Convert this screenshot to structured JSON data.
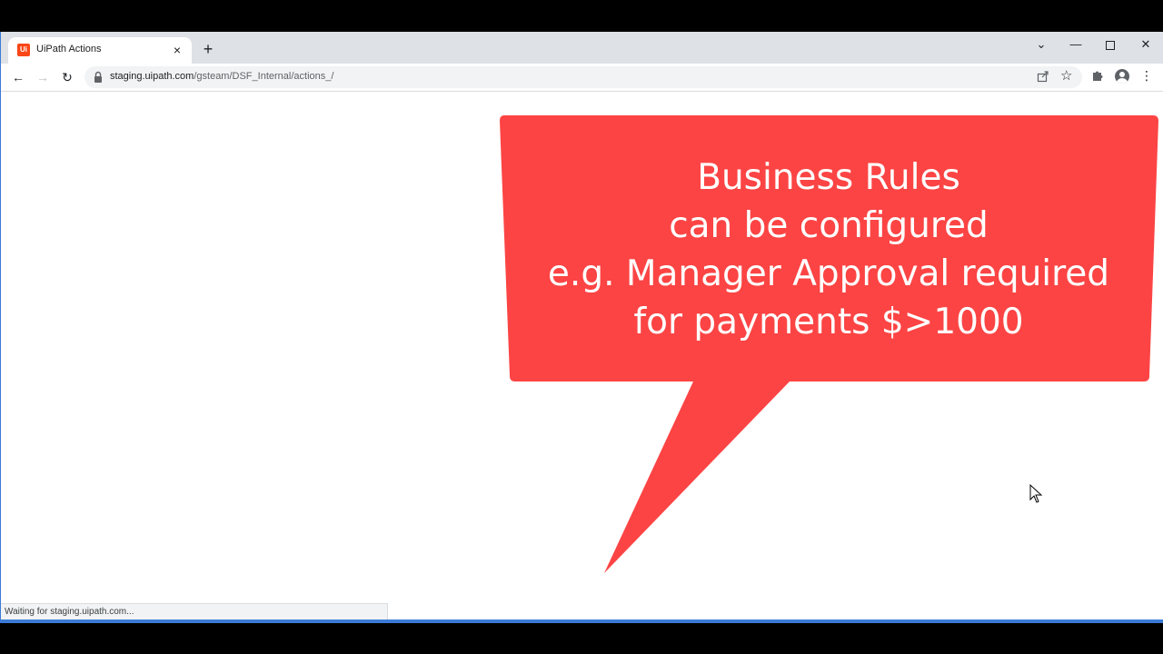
{
  "browser": {
    "tab": {
      "title": "UiPath Actions",
      "favicon_text": "Ui",
      "close_glyph": "×"
    },
    "new_tab_glyph": "+",
    "window_controls": {
      "tab_search_glyph": "⌄",
      "minimize_glyph": "—",
      "close_glyph": "✕"
    },
    "nav": {
      "back_glyph": "←",
      "forward_glyph": "→",
      "reload_glyph": "↻"
    },
    "address": {
      "host": "staging.uipath.com",
      "path": "/gsteam/DSF_Internal/actions_/"
    },
    "toolbar_icons": {
      "star_glyph": "☆",
      "menu_glyph": "⋮"
    }
  },
  "callout": {
    "lines": [
      "Business Rules",
      "can be configured",
      "e.g. Manager Approval required",
      "for payments $>1000"
    ],
    "color": "#fc4444"
  },
  "status": {
    "text": "Waiting for staging.uipath.com..."
  }
}
